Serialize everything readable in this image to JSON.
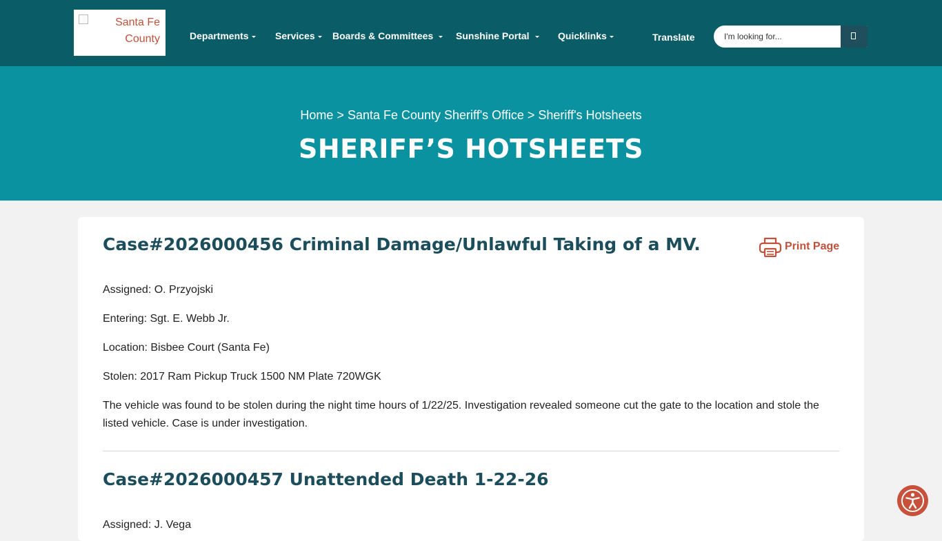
{
  "header": {
    "logo_alt": "Santa Fe County",
    "nav": [
      {
        "label": "Departments",
        "dropdown": true
      },
      {
        "label": "Services",
        "dropdown": true
      },
      {
        "label": "Boards & Committees",
        "dropdown": true
      },
      {
        "label": "Sunshine Portal",
        "dropdown": true
      },
      {
        "label": "Quicklinks",
        "dropdown": true
      },
      {
        "label": "Translate",
        "dropdown": false
      }
    ],
    "search": {
      "placeholder": "I'm looking for...",
      "button_icon": "search-icon"
    }
  },
  "hero": {
    "breadcrumb": {
      "home": "Home",
      "separator": ">",
      "parent": "Santa Fe County Sheriff's Office",
      "current": "Sheriff's Hotsheets"
    },
    "title": "SHERIFF’S HOTSHEETS"
  },
  "print": {
    "label": "Print Page",
    "icon": "printer-icon"
  },
  "cases": [
    {
      "title": "Case#2026000456 Criminal Damage/Unlawful Taking of a MV.",
      "assigned": "Assigned: O. Przyojski",
      "entering": "Entering: Sgt. E. Webb Jr.",
      "location": "Location: Bisbee Court (Santa Fe)",
      "stolen": "Stolen: 2017 Ram Pickup Truck 1500 NM Plate 720WGK",
      "description": "The vehicle was found to be stolen during the night time hours of 1/22/25. Investigation revealed someone cut the gate to the location and stole the listed vehicle. Case is under investigation."
    },
    {
      "title": "Case#2026000457 Unattended Death 1-22-26",
      "assigned": "Assigned: J. Vega"
    }
  ],
  "colors": {
    "header_bg": "#0a5c67",
    "hero_bg": "#0b92a0",
    "title_text": "#1c4d5b",
    "accent": "#c0513b",
    "search_button": "#1f4e5c"
  },
  "accessibility": {
    "icon": "accessibility-icon"
  }
}
